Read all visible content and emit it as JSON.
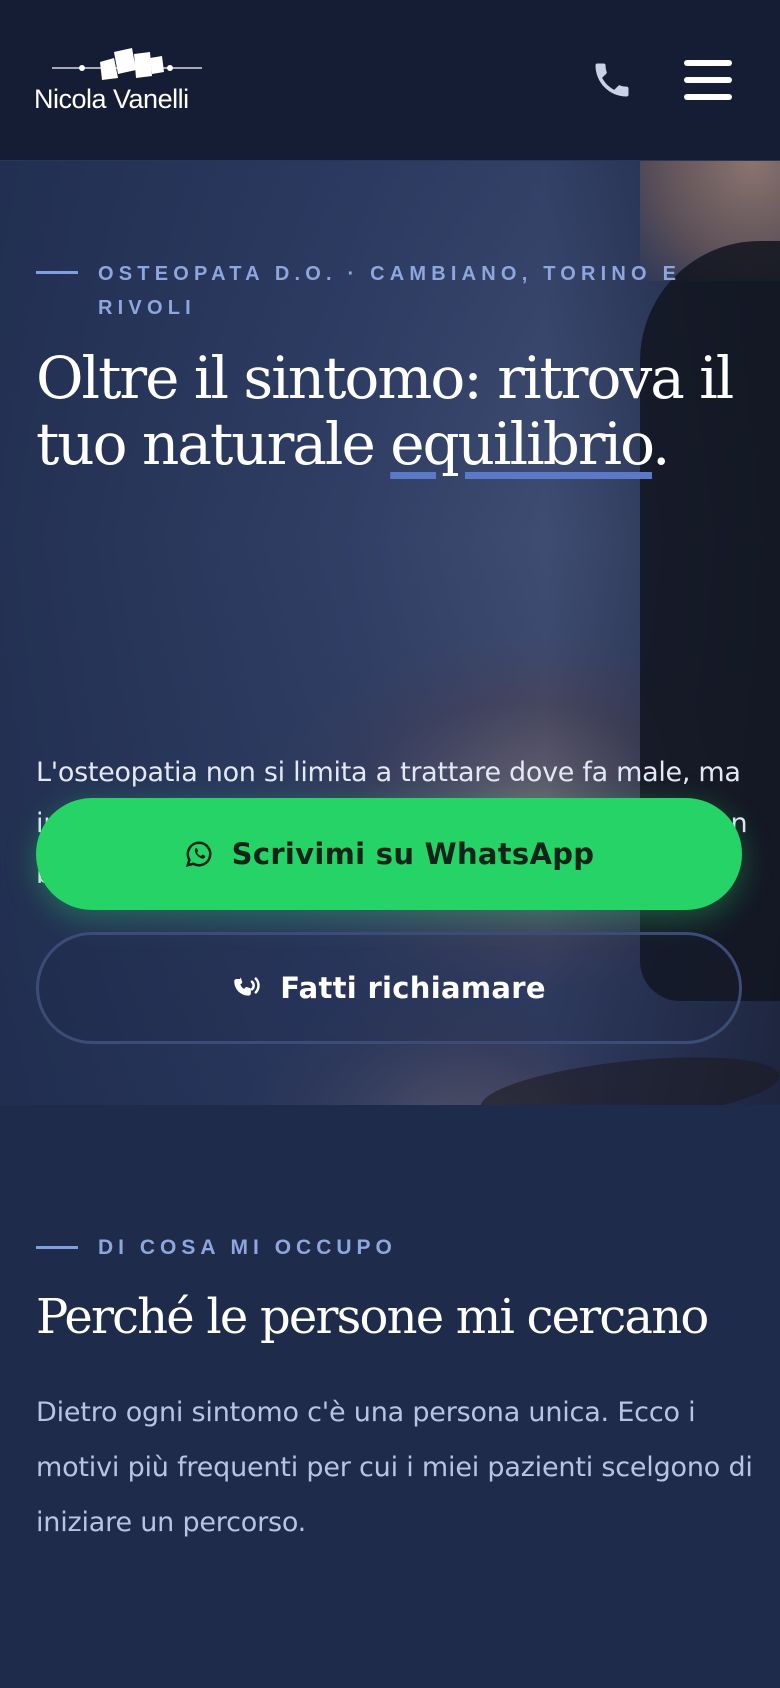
{
  "header": {
    "brand": "Nicola Vanelli",
    "icons": {
      "phone": "phone-icon",
      "menu": "hamburger-menu-icon"
    }
  },
  "hero": {
    "eyebrow": "OSTEOPATA D.O. · CAMBIANO, TORINO E RIVOLI",
    "title_part1": "Oltre il sintomo: ritrova il tuo naturale ",
    "title_highlight": "equilibrio",
    "title_end": ".",
    "lead": "L'osteopatia non si limita a trattare dove fa male, ma individua la vera causa del problema per restituirti un benessere profondo e duraturo.",
    "cta_whatsapp": "Scrivimi su WhatsApp",
    "cta_callback": "Fatti richiamare"
  },
  "section": {
    "eyebrow": "DI COSA MI OCCUPO",
    "title": "Perché le persone mi cercano",
    "text": "Dietro ogni sintomo c'è una persona unica. Ecco i motivi più frequenti per cui i miei pazienti scelgono di iniziare un percorso."
  },
  "colors": {
    "header_bg": "#141d33",
    "page_bg": "#1f2b4a",
    "accent": "#7ea0e0",
    "whatsapp_green": "#25d366"
  }
}
